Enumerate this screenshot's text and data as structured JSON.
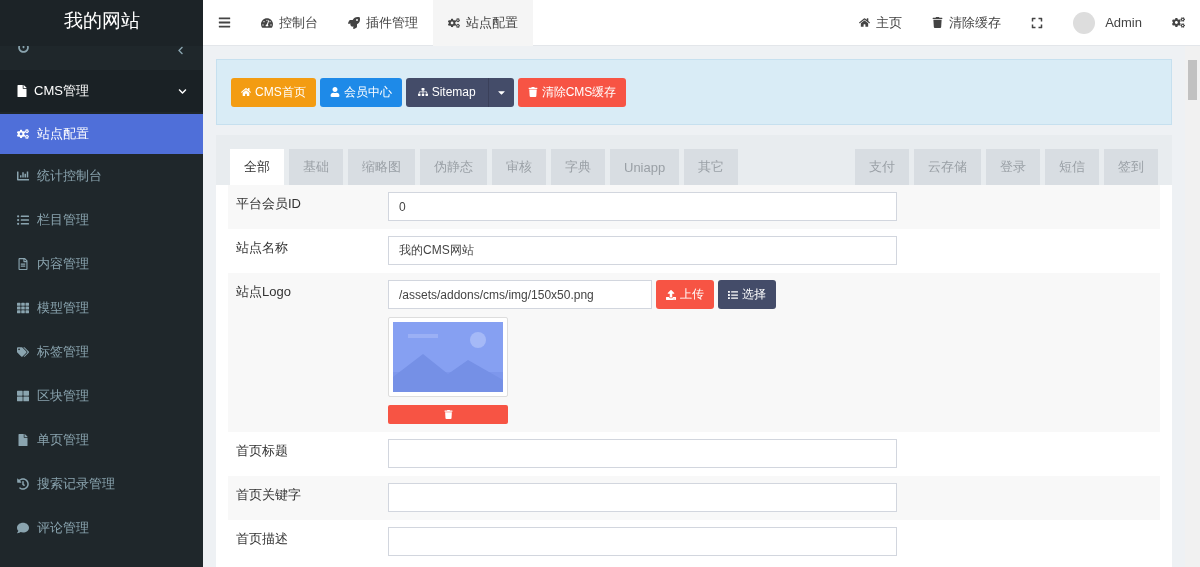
{
  "brand": {
    "title": "我的网站"
  },
  "sidebar": {
    "items": [
      {
        "label": "CMS管理",
        "expanded": true,
        "selected": false,
        "children": [
          {
            "label": "站点配置",
            "selected": true
          },
          {
            "label": "统计控制台",
            "selected": false
          },
          {
            "label": "栏目管理",
            "selected": false
          },
          {
            "label": "内容管理",
            "selected": false
          },
          {
            "label": "模型管理",
            "selected": false
          },
          {
            "label": "标签管理",
            "selected": false
          },
          {
            "label": "区块管理",
            "selected": false
          },
          {
            "label": "单页管理",
            "selected": false
          },
          {
            "label": "搜索记录管理",
            "selected": false
          },
          {
            "label": "评论管理",
            "selected": false
          }
        ]
      }
    ]
  },
  "topbar": {
    "tabs": [
      {
        "label": "控制台",
        "selected": false
      },
      {
        "label": "插件管理",
        "selected": false
      },
      {
        "label": "站点配置",
        "selected": true
      }
    ],
    "right": [
      {
        "label": "主页"
      },
      {
        "label": "清除缓存"
      }
    ],
    "user": "Admin"
  },
  "actions": [
    {
      "label": "CMS首页",
      "color": "#f39c12"
    },
    {
      "label": "会员中心",
      "color": "#1e8ae8"
    },
    {
      "label": "Sitemap",
      "color": "#444c69"
    },
    {
      "label": "清除CMS缓存",
      "color": "#f75444"
    }
  ],
  "tabs_left": [
    {
      "label": "全部",
      "selected": true
    },
    {
      "label": "基础",
      "selected": false
    },
    {
      "label": "缩略图",
      "selected": false
    },
    {
      "label": "伪静态",
      "selected": false
    },
    {
      "label": "审核",
      "selected": false
    },
    {
      "label": "字典",
      "selected": false
    },
    {
      "label": "Uniapp",
      "selected": false
    },
    {
      "label": "其它",
      "selected": false
    }
  ],
  "tabs_right": [
    {
      "label": "支付",
      "selected": false
    },
    {
      "label": "云存储",
      "selected": false
    },
    {
      "label": "登录",
      "selected": false
    },
    {
      "label": "短信",
      "selected": false
    },
    {
      "label": "签到",
      "selected": false
    }
  ],
  "form": [
    {
      "kind": "text",
      "label": "平台会员ID",
      "value": "0"
    },
    {
      "kind": "text",
      "label": "站点名称",
      "value": "我的CMS网站"
    },
    {
      "label": "站点Logo",
      "value": "/assets/addons/cms/img/150x50.png",
      "upload": "上传",
      "choose": "选择"
    },
    {
      "kind": "text",
      "label": "首页标题"
    },
    {
      "kind": "text",
      "label": "首页关键字"
    },
    {
      "kind": "text",
      "label": "首页描述"
    }
  ]
}
